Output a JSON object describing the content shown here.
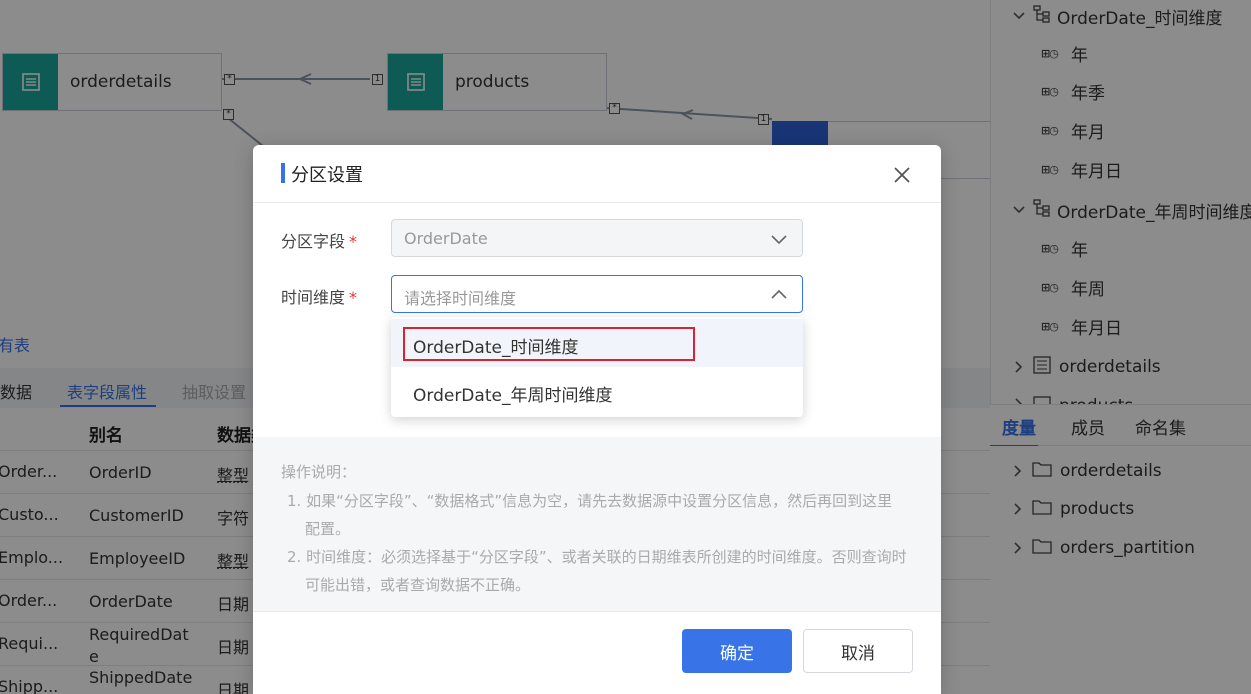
{
  "canvas": {
    "nodes": [
      {
        "label": "orderdetails"
      },
      {
        "label": "products"
      }
    ],
    "multiplicity": {
      "many": "*",
      "one": "1"
    }
  },
  "lower": {
    "all_tables_link": "所有表",
    "tabs": [
      "数据",
      "表字段属性",
      "抽取设置"
    ],
    "columns": [
      "别名",
      "数据类"
    ],
    "rows": [
      {
        "name": "Order...",
        "alias": "OrderID",
        "type": "整型"
      },
      {
        "name": "Custo...",
        "alias": "CustomerID",
        "type": "字符"
      },
      {
        "name": "Emplo...",
        "alias": "EmployeeID",
        "type": "整型"
      },
      {
        "name": "Order...",
        "alias": "OrderDate",
        "type": "日期"
      },
      {
        "name": "Requi...",
        "alias": "RequiredDate",
        "type": "日期"
      },
      {
        "name": "Shipp...",
        "alias": "ShippedDate",
        "type": "日期"
      }
    ]
  },
  "tree": {
    "group1": "OrderDate_时间维度",
    "group1_items": [
      "年",
      "年季",
      "年月",
      "年月日"
    ],
    "group2": "OrderDate_年周时间维度",
    "group2_items": [
      "年",
      "年周",
      "年月日"
    ],
    "tables": [
      "orderdetails",
      "products"
    ]
  },
  "bottom_panel": {
    "tabs": [
      "度量",
      "成员",
      "命名集"
    ],
    "items": [
      "orderdetails",
      "products",
      "orders_partition"
    ]
  },
  "modal": {
    "title": "分区设置",
    "field_label": "分区字段",
    "field_value": "OrderDate",
    "dim_label": "时间维度",
    "dim_placeholder": "请选择时间维度",
    "required_mark": "*",
    "options": [
      "OrderDate_时间维度",
      "OrderDate_年周时间维度"
    ],
    "help_title": "操作说明：",
    "help_lines": [
      "1. 如果“分区字段”、“数据格式”信息为空，请先去数据源中设置分区信息，然后再回到这里配置。",
      "2. 时间维度：必须选择基于“分区字段”、或者关联的日期维表所创建的时间维度。否则查询时可能出错，或者查询数据不正确。"
    ],
    "confirm": "确定",
    "cancel": "取消"
  }
}
